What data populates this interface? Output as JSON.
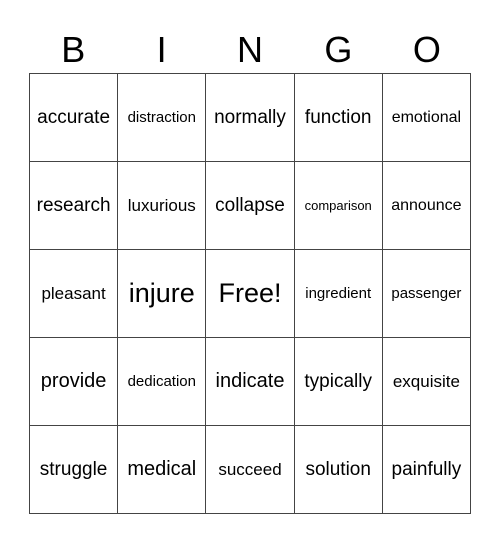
{
  "header": [
    "B",
    "I",
    "N",
    "G",
    "O"
  ],
  "cells": [
    [
      "accurate",
      "distraction",
      "normally",
      "function",
      "emotional"
    ],
    [
      "research",
      "luxurious",
      "collapse",
      "comparison",
      "announce"
    ],
    [
      "pleasant",
      "injure",
      "Free!",
      "ingredient",
      "passenger"
    ],
    [
      "provide",
      "dedication",
      "indicate",
      "typically",
      "exquisite"
    ],
    [
      "struggle",
      "medical",
      "succeed",
      "solution",
      "painfully"
    ]
  ]
}
